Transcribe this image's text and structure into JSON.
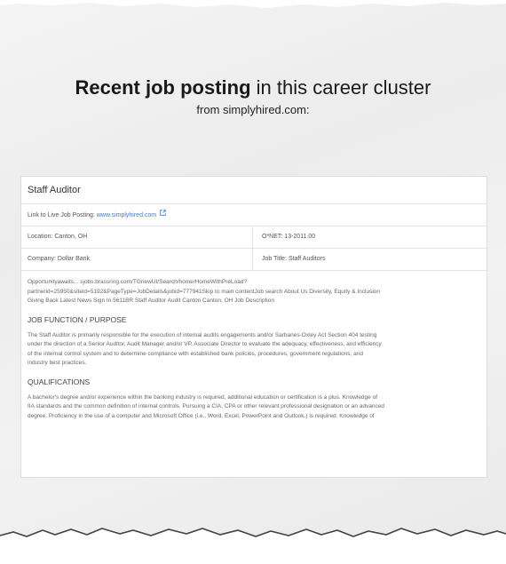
{
  "heading": {
    "bold": "Recent job posting",
    "rest": " in this career cluster",
    "source": "from simplyhired.com:"
  },
  "job": {
    "title": "Staff Auditor",
    "link_label": "Link to Live Job Posting:",
    "link_text": "www.simplyhired.com",
    "location_label": "Location:",
    "location_value": "Canton, OH",
    "onet_label": "O*NET:",
    "onet_value": "13-2011.00",
    "company_label": "Company:",
    "company_value": "Dollar Bank",
    "jobtitle_label": "Job Title:",
    "jobtitle_value": "Staff Auditors",
    "intro_line1": "Opportunityawaits... sjobs.brassring.com/TGnewUI/Search/home/HomeWithPreLoad?",
    "intro_line2": "partnerid=25950&siteid=5192&PageType=JobDetails&jobid=777941Skip to main contentJob search About Us Diversity, Equity & Inclusion",
    "intro_line3": "Giving Back Latest News Sign In 5611BR Staff Auditor Audit Canton Canton, OH Job Description",
    "section1_title": "JOB FUNCTION / PURPOSE",
    "section1_line1": "The Staff Auditor is primarily responsible for the execution of internal audits engagements and/or Sarbanes-Oxley Act Section 404 testing",
    "section1_line2": "under the direction of a Senior Auditor, Audit Manager and/or VP, Associate Director to evaluate the adequacy, effectiveness, and efficiency",
    "section1_line3": "of the internal control system and to determine compliance with established bank policies, procedures, government regulations, and",
    "section1_line4": "industry best practices.",
    "section2_title": "QUALIFICATIONS",
    "section2_line1": "A bachelor's degree and/or experience within the banking industry is required, additional education or certification is a plus. Knowledge of",
    "section2_line2": "IIA standards and the common definition of internal controls. Pursuing a CIA, CPA or other relevant professional designation or an advanced",
    "section2_line3": "degree. Proficiency in the use of a computer and Microsoft Office (i.e., Word, Excel, PowerPoint and Outlook.) is required. Knowledge of"
  },
  "colors": {
    "link": "#3a7bc8",
    "paper": "#eeeeee",
    "text": "#1a1a1a"
  },
  "icons": {
    "external_link": "external-link-icon"
  }
}
